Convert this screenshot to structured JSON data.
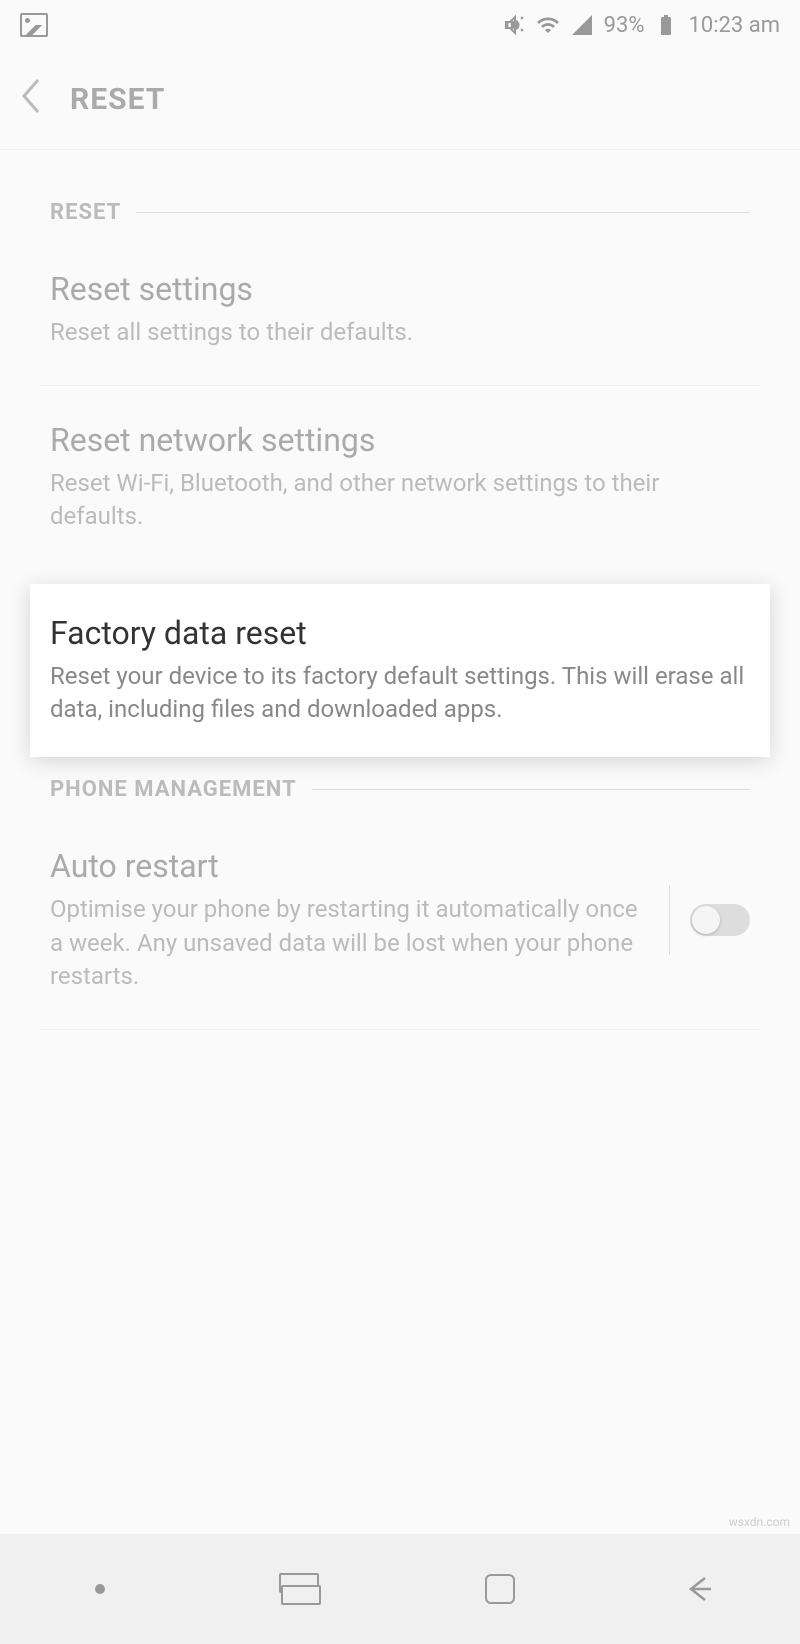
{
  "statusBar": {
    "battery": "93%",
    "time": "10:23 am"
  },
  "appBar": {
    "title": "RESET"
  },
  "sections": {
    "reset": {
      "header": "RESET",
      "items": [
        {
          "title": "Reset settings",
          "subtitle": "Reset all settings to their defaults."
        },
        {
          "title": "Reset network settings",
          "subtitle": "Reset Wi-Fi, Bluetooth, and other network settings to their defaults."
        },
        {
          "title": "Factory data reset",
          "subtitle": "Reset your device to its factory default settings. This will erase all data, including files and downloaded apps."
        }
      ]
    },
    "phoneManagement": {
      "header": "PHONE MANAGEMENT",
      "items": [
        {
          "title": "Auto restart",
          "subtitle": "Optimise your phone by restarting it automatically once a week. Any unsaved data will be lost when your phone restarts."
        }
      ]
    }
  },
  "watermark": "wsxdn.com"
}
